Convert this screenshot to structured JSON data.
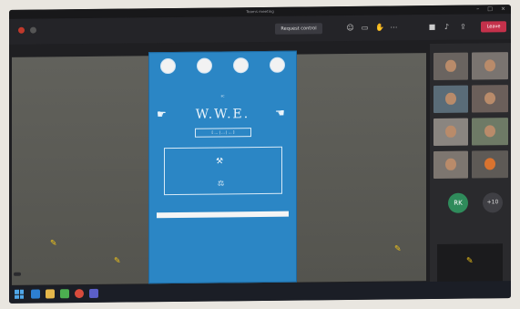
{
  "window": {
    "title": "Teams meeting"
  },
  "toolbar": {
    "request_control": "Request control",
    "leave_label": "Leave"
  },
  "poster": {
    "header_lines": [
      "",
      "",
      "",
      "IIC"
    ],
    "title": "W.W.E.",
    "subtitle": "[ ... | ... | ... ]",
    "box_lines": [
      "",
      "",
      ""
    ],
    "link": "",
    "details": [
      "",
      "",
      "",
      "",
      "",
      ""
    ]
  },
  "presenter": {
    "label": ""
  },
  "participants": {
    "rk_initials": "RK",
    "rk_name": "",
    "more_count": "+10"
  },
  "taskbar": {
    "time": "",
    "date": ""
  },
  "colors": {
    "poster_bg": "#2b86c5",
    "leave_red": "#c4314b",
    "avatar_green": "#2f8b5b"
  },
  "icons": [
    "windows-start-icon",
    "edge-icon",
    "file-explorer-icon",
    "store-icon",
    "chrome-icon",
    "teams-icon"
  ]
}
